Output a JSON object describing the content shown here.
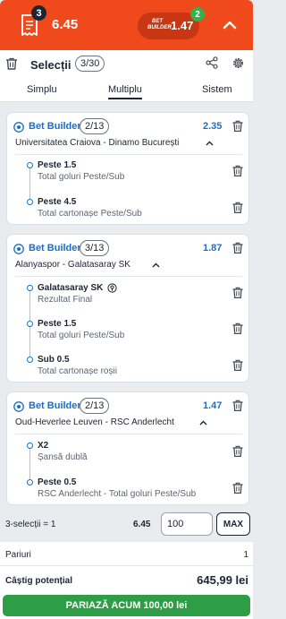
{
  "header": {
    "slip_count": "3",
    "total_odds": "6.45",
    "builder_logo_top": "BET",
    "builder_logo_bottom": "BUILDER",
    "builder_odds": "1.47",
    "builder_count": "2"
  },
  "panel": {
    "title": "Selecții",
    "count": "3/30",
    "tabs": [
      "Simplu",
      "Multiplu",
      "Sistem"
    ]
  },
  "cards": [
    {
      "label": "Bet Builder",
      "legs": "2/13",
      "odds": "2.35",
      "event": "Universitatea Craiova - Dinamo București",
      "picks": [
        {
          "pick": "Peste 1.5",
          "market": "Total goluri Peste/Sub"
        },
        {
          "pick": "Peste 4.5",
          "market": "Total cartonașe Peste/Sub"
        }
      ]
    },
    {
      "label": "Bet Builder",
      "legs": "3/13",
      "odds": "1.87",
      "event": "Alanyaspor - Galatasaray SK",
      "picks": [
        {
          "pick": "Galatasaray SK",
          "market": "Rezultat Final"
        },
        {
          "pick": "Peste 1.5",
          "market": "Total goluri Peste/Sub"
        },
        {
          "pick": "Sub 0.5",
          "market": "Total cartonașe roșii"
        }
      ]
    },
    {
      "label": "Bet Builder",
      "legs": "2/13",
      "odds": "1.47",
      "event": "Oud-Heverlee Leuven - RSC Anderlecht",
      "picks": [
        {
          "pick": "X2",
          "market": "Șansă dublă"
        },
        {
          "pick": "Peste 0.5",
          "market": "RSC Anderlecht - Total goluri Peste/Sub"
        }
      ]
    }
  ],
  "stake": {
    "selections": "3-selecții = 1",
    "odds": "6.45",
    "amount": "100",
    "max_label": "MAX"
  },
  "summary": {
    "bets_label": "Pariuri",
    "bets_value": "1",
    "win_label": "Câștig potențial",
    "win_value": "645,99 lei",
    "place_label": "PARIAZĂ ACUM 100,00 lei"
  },
  "colors": {
    "brand": "#f0491c",
    "accent": "#1d6ec2",
    "success": "#2e9e46"
  },
  "icons": [
    "betslip-icon",
    "chevron-up-icon",
    "trash-icon",
    "share-icon",
    "settings-icon",
    "soccer-ball-icon",
    "chevron-up-icon",
    "pin-icon"
  ]
}
